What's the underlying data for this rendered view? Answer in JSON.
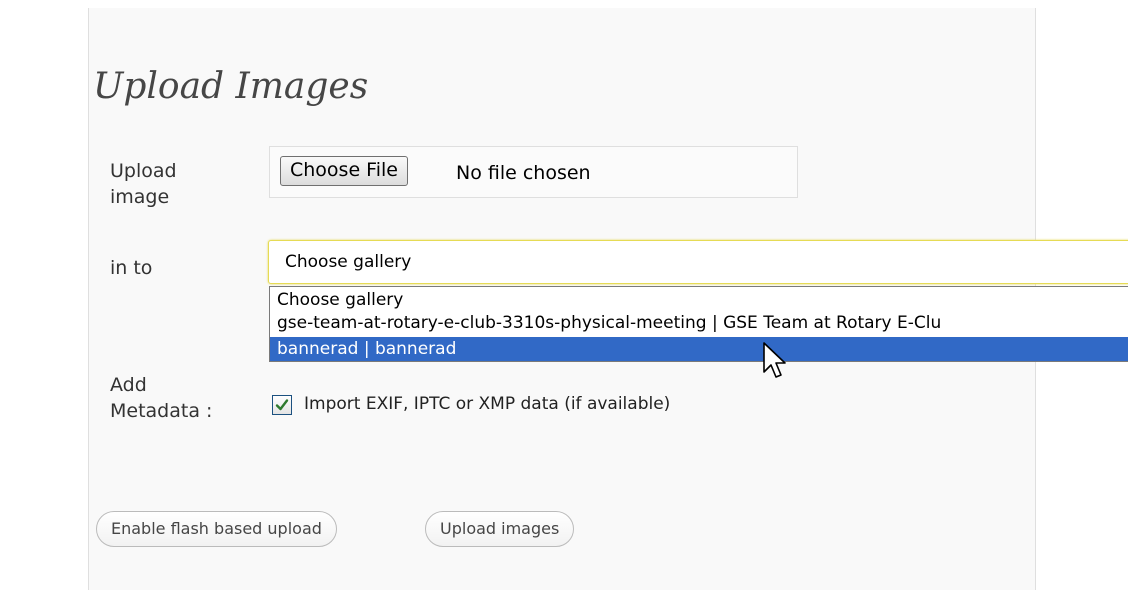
{
  "page": {
    "title": "Upload Images"
  },
  "upload": {
    "label": "Upload image",
    "choose_file_label": "Choose File",
    "status": "No file chosen"
  },
  "gallery": {
    "label": "in to",
    "selected": "Choose gallery",
    "options": [
      {
        "label": "Choose gallery",
        "highlighted": false
      },
      {
        "label": "gse-team-at-rotary-e-club-3310s-physical-meeting | GSE Team at Rotary E-Clu",
        "highlighted": false
      },
      {
        "label": "bannerad | bannerad",
        "highlighted": true
      }
    ]
  },
  "metadata": {
    "label": "Add Metadata :",
    "checkbox_label": "Import EXIF, IPTC or XMP data (if available)",
    "checked": true
  },
  "buttons": {
    "flash_upload": "Enable flash based upload",
    "upload_images": "Upload images"
  },
  "colors": {
    "highlight": "#3169c6",
    "select_focus_border": "#e6db55",
    "check_mark": "#2f7a2f"
  },
  "icons": {
    "checkbox": "check-icon",
    "pointer": "mouse-pointer-icon"
  }
}
